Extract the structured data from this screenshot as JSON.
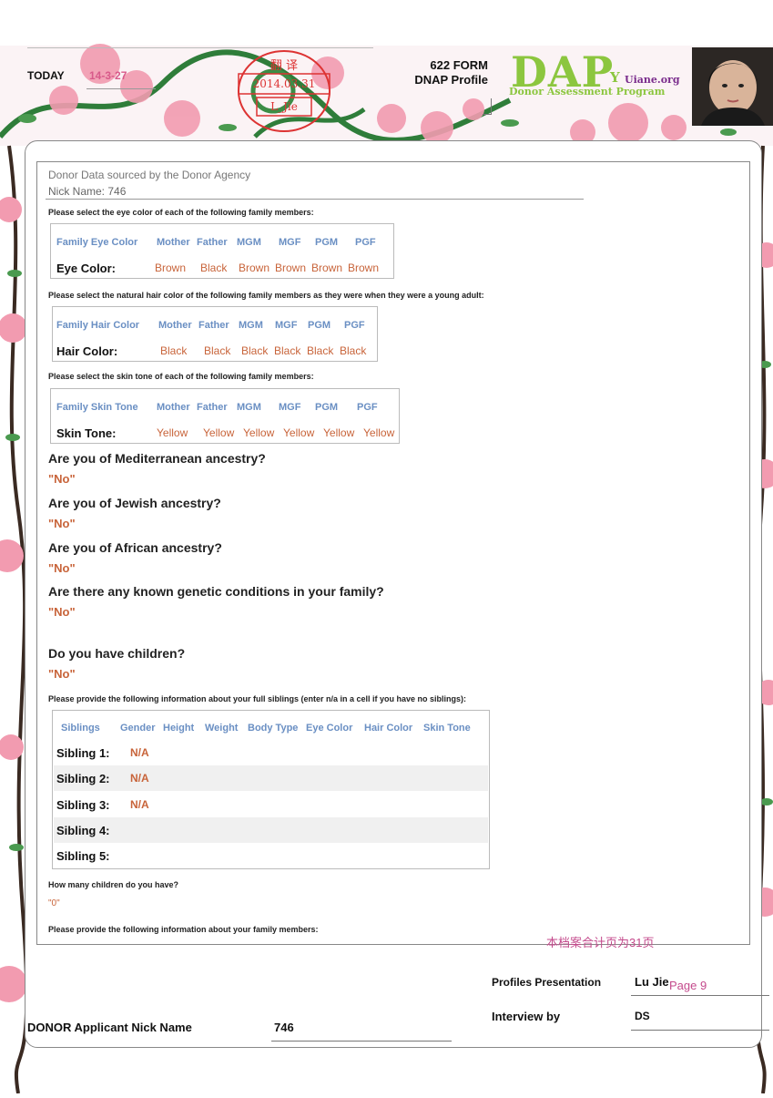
{
  "header": {
    "today_label": "TODAY",
    "today_date": "14-3-27",
    "stamp": {
      "line1": "翻 译",
      "line2": "2014.03.31",
      "line3": "L_Jie"
    },
    "form_title_1": "622 FORM",
    "form_title_2": "DNAP Profile",
    "logo": {
      "main": "DAP",
      "y": "Y",
      "site": "Uiane.org",
      "sub": "Donor Assessment Program"
    }
  },
  "section": {
    "sourced": "Donor Data sourced by the Donor Agency",
    "nick": "Nick Name: 746"
  },
  "eye": {
    "instruction": "Please select the eye color of each of the following family members:",
    "headers": [
      "Family Eye Color",
      "Mother",
      "Father",
      "MGM",
      "MGF",
      "PGM",
      "PGF"
    ],
    "label": "Eye Color:",
    "values": [
      "Brown",
      "Black",
      "Brown",
      "Brown",
      "Brown",
      "Brown"
    ]
  },
  "hair": {
    "instruction": "Please select the natural hair color of the following family members as they were when they were a young adult:",
    "headers": [
      "Family Hair Color",
      "Mother",
      "Father",
      "MGM",
      "MGF",
      "PGM",
      "PGF"
    ],
    "label": "Hair Color:",
    "values": [
      "Black",
      "Black",
      "Black",
      "Black",
      "Black",
      "Black"
    ]
  },
  "skin": {
    "instruction": "Please select the skin tone of each of the following family members:",
    "headers": [
      "Family Skin Tone",
      "Mother",
      "Father",
      "MGM",
      "MGF",
      "PGM",
      "PGF"
    ],
    "label": "Skin Tone:",
    "values": [
      "Yellow",
      "Yellow",
      "Yellow",
      "Yellow",
      "Yellow",
      "Yellow"
    ]
  },
  "questions": [
    {
      "q": "Are you of Mediterranean ancestry?",
      "a": "\"No\""
    },
    {
      "q": "Are you of Jewish ancestry?",
      "a": "\"No\""
    },
    {
      "q": "Are you of African ancestry?",
      "a": "\"No\""
    },
    {
      "q": "Are there any known genetic conditions in your family?",
      "a": "\"No\""
    },
    {
      "q": "Do you have children?",
      "a": "\"No\""
    }
  ],
  "siblings": {
    "instruction": "Please provide the following information about your full siblings (enter n/a in a cell if you have no siblings):",
    "headers": [
      "Siblings",
      "Gender",
      "Height",
      "Weight",
      "Body Type",
      "Eye Color",
      "Hair Color",
      "Skin Tone"
    ],
    "rows": [
      {
        "label": "Sibling 1:",
        "value": "N/A"
      },
      {
        "label": "Sibling 2:",
        "value": "N/A"
      },
      {
        "label": "Sibling 3:",
        "value": "N/A"
      },
      {
        "label": "Sibling 4:",
        "value": ""
      },
      {
        "label": "Sibling 5:",
        "value": ""
      }
    ]
  },
  "children": {
    "question": "How many children do you have?",
    "answer": "\"0\""
  },
  "family_instruction": "Please provide the following information about your family members:",
  "footnote": "本档案合计页为31页",
  "footer": {
    "profiles_label": "Profiles Presentation",
    "profiles_value": "Lu Jie",
    "page": "Page 9",
    "interview_label": "Interview by",
    "interview_value": "DS",
    "applicant_label": "DONOR Applicant Nick Name",
    "applicant_value": "746"
  }
}
